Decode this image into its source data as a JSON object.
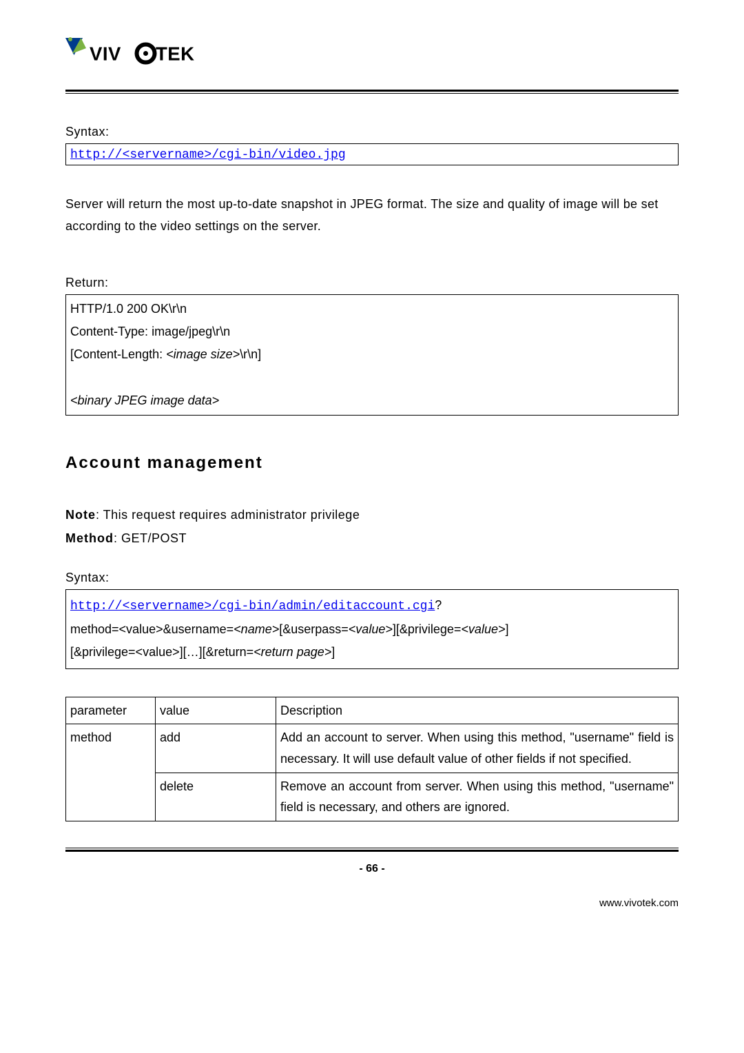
{
  "logo": {
    "brand": "VIVOTEK"
  },
  "snapshot": {
    "syntax_label": "Syntax:",
    "url": "http://<servername>/cgi-bin/video.jpg",
    "description": "Server will return the most up-to-date snapshot in JPEG format. The size and quality of image will be set according to the video settings on the server.",
    "return_label": "Return:",
    "return_lines": {
      "l1": "HTTP/1.0 200 OK\\r\\n",
      "l2": "Content-Type: image/jpeg\\r\\n",
      "l3_pre": "[Content-Length: ",
      "l3_em": "<image size>",
      "l3_post": "\\r\\n]",
      "l4": "<binary JPEG image data>"
    }
  },
  "account": {
    "title": "Account management",
    "note_label": "Note",
    "note_text": ": This request requires administrator privilege",
    "method_label": "Method",
    "method_text": ": GET/POST",
    "syntax_label": "Syntax:",
    "url": "http://<servername>/cgi-bin/admin/editaccount.cgi",
    "url_q": "?",
    "p2_a": "method=<value>&username=",
    "p2_b": "<name>",
    "p2_c": "[&userpass=",
    "p2_d": "<value>",
    "p2_e": "][&privilege=",
    "p2_f": "<value>",
    "p2_g": "]",
    "p3_a": "[&privilege=<value>][…][&return=",
    "p3_b": "<return page>",
    "p3_c": "]"
  },
  "table": {
    "headers": {
      "param": "parameter",
      "value": "value",
      "desc": "Description"
    },
    "rows": [
      {
        "param": "method",
        "value": "add",
        "desc": "Add an account to server. When using this method, \"username\" field is necessary. It will use default value of other fields if not specified."
      },
      {
        "param": "",
        "value": "delete",
        "desc": "Remove an account from server. When using this method, \"username\" field is necessary, and others are ignored."
      }
    ]
  },
  "footer": {
    "page": "- 66 -",
    "site": "www.vivotek.com"
  }
}
